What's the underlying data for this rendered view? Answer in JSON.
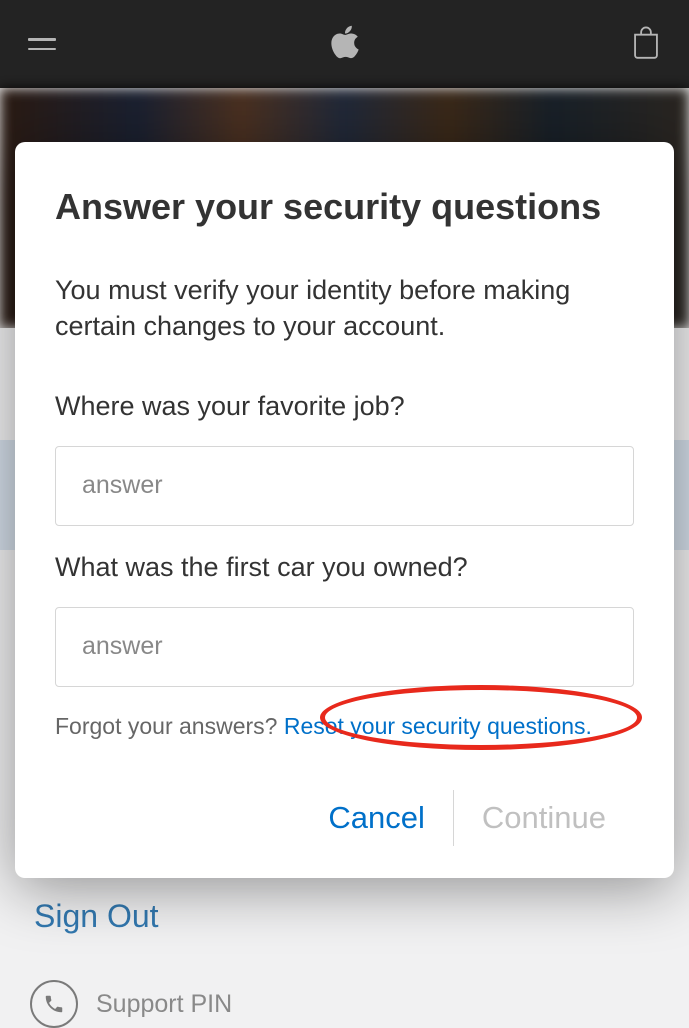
{
  "navbar": {
    "menu_label": "menu",
    "logo_label": "apple",
    "bag_label": "bag"
  },
  "background": {
    "signout_label": "Sign Out",
    "support_pin_label": "Support PIN"
  },
  "modal": {
    "title": "Answer your security questions",
    "subtitle": "You must verify your identity before making certain changes to your account.",
    "questions": [
      {
        "label": "Where was your favorite job?",
        "placeholder": "answer",
        "value": ""
      },
      {
        "label": "What was the first car you owned?",
        "placeholder": "answer",
        "value": ""
      }
    ],
    "forgot_prefix": "Forgot your answers? ",
    "reset_link": "Reset your security questions.",
    "buttons": {
      "cancel": "Cancel",
      "continue": "Continue"
    }
  }
}
